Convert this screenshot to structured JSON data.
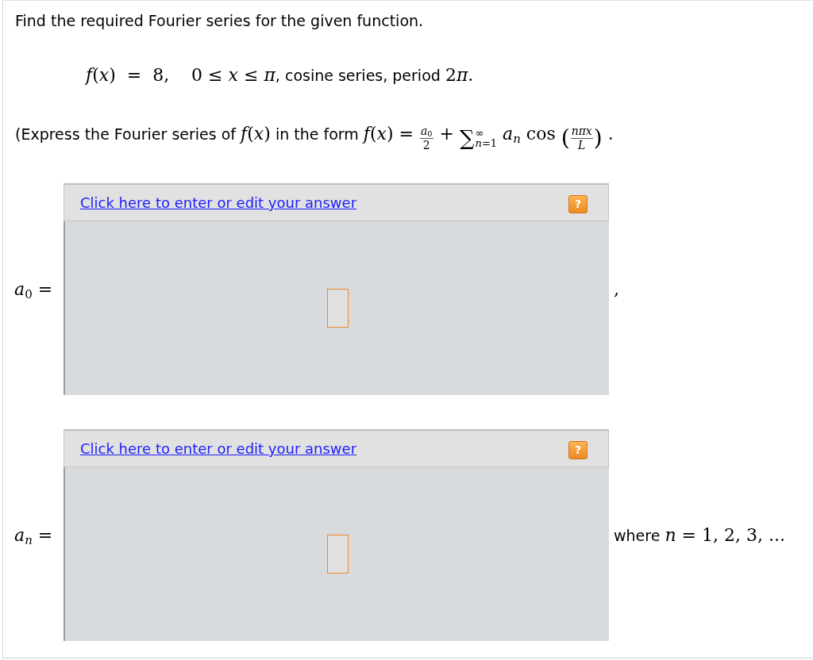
{
  "instruction": "Find the required Fourier series for the given function.",
  "problem": [
    {
      "kind": "math",
      "text": "*f*(*x*)  =  8,    0 ≤ *x* ≤ *π*"
    },
    {
      "kind": "text",
      "text": ", cosine series, period "
    },
    {
      "kind": "math",
      "text": "2"
    },
    {
      "kind": "var",
      "text": "π"
    },
    {
      "kind": "math",
      "text": "."
    }
  ],
  "form_hint": [
    {
      "kind": "text",
      "text": "(Express the Fourier series of "
    },
    {
      "kind": "math",
      "text": "*f*(*x*)"
    },
    {
      "kind": "text",
      "text": " in the form "
    },
    {
      "kind": "math",
      "text": "*f*(*x*) = "
    },
    {
      "kind": "fraction",
      "numerator": "*a*$_{0}$",
      "denominator": "2"
    },
    {
      "kind": "math",
      "text": " + "
    },
    {
      "kind": "sum",
      "symbol": "∑",
      "upper": "∞",
      "lower": "*n*=1"
    },
    {
      "kind": "var",
      "text": " a$_{n}$"
    },
    {
      "kind": "math",
      "text": " cos "
    },
    {
      "kind": "delimiter",
      "text": "("
    },
    {
      "kind": "fraction",
      "numerator": "*nπx*",
      "denominator": "*L*"
    },
    {
      "kind": "delimiter",
      "text": ")"
    },
    {
      "kind": "math",
      "text": " ."
    }
  ],
  "answers": [
    {
      "label": [
        {
          "kind": "math",
          "text": "*a*$_{0}$ ="
        }
      ],
      "link": "Click here to enter or edit your answer",
      "help": "?",
      "after": [
        {
          "kind": "math",
          "text": ","
        }
      ]
    },
    {
      "label": [
        {
          "kind": "var",
          "text": "a$_{n}$"
        },
        {
          "kind": "math",
          "text": " ="
        }
      ],
      "link": "Click here to enter or edit your answer",
      "help": "?",
      "after": [
        {
          "kind": "text",
          "text": "where "
        },
        {
          "kind": "var",
          "text": "n"
        },
        {
          "kind": "math",
          "text": " = 1, 2, 3, ..."
        }
      ]
    }
  ]
}
